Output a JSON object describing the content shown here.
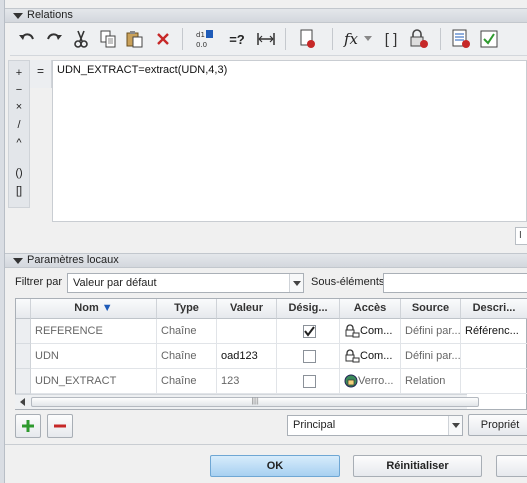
{
  "relations": {
    "title": "Relations",
    "operators": [
      "+",
      "−",
      "×",
      "/",
      "^",
      "()",
      "[]"
    ],
    "equals": "=",
    "formula": "UDN_EXTRACT=extract(UDN,4,3)",
    "side_box": "I"
  },
  "params": {
    "title": "Paramètres locaux",
    "filter_label": "Filtrer par",
    "filter_value": "Valeur par défaut",
    "sub_label": "Sous-éléments",
    "columns": [
      "Nom",
      "Type",
      "Valeur",
      "Désig...",
      "Accès",
      "Source",
      "Descri..."
    ],
    "rows": [
      {
        "name": "REFERENCE",
        "type": "Chaîne",
        "value": "",
        "designated": true,
        "access": "Com...",
        "source": "Défini par...",
        "desc": "Référenc..."
      },
      {
        "name": "UDN",
        "type": "Chaîne",
        "value": "oad123",
        "designated": false,
        "access": "Com...",
        "source": "Défini par...",
        "desc": ""
      },
      {
        "name": "UDN_EXTRACT",
        "type": "Chaîne",
        "value": "123",
        "designated": false,
        "access": "Verro...",
        "source": "Relation",
        "desc": ""
      }
    ],
    "scope_value": "Principal",
    "properties_label": "Propriét"
  },
  "footer": {
    "ok_label": "OK",
    "reset_label": "Réinitialiser"
  },
  "colors": {
    "accent": "#a7d0f1",
    "add": "#2e9a2e",
    "remove": "#c62828"
  }
}
